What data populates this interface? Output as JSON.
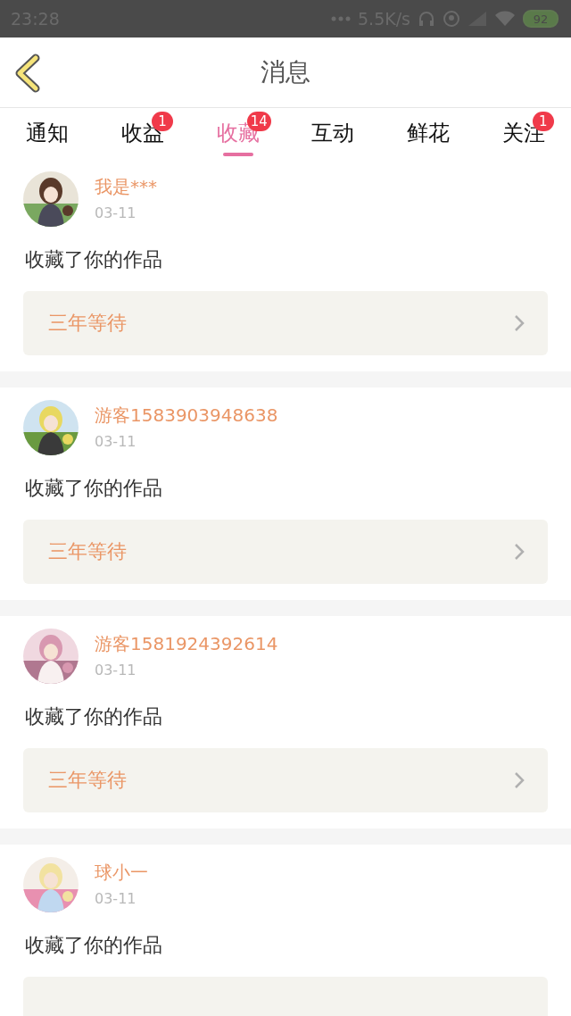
{
  "status_bar": {
    "time": "23:28",
    "speed": "5.5K/s",
    "battery": "92"
  },
  "header": {
    "title": "消息"
  },
  "tabs": [
    {
      "label": "通知",
      "selected": false
    },
    {
      "label": "收益",
      "selected": false,
      "badge": "1"
    },
    {
      "label": "收藏",
      "selected": true,
      "badge": "14"
    },
    {
      "label": "互动",
      "selected": false
    },
    {
      "label": "鲜花",
      "selected": false
    },
    {
      "label": "关注",
      "selected": false,
      "badge": "1"
    }
  ],
  "messages": [
    {
      "user": "我是***",
      "date": "03-11",
      "text": "收藏了你的作品",
      "work": "三年等待"
    },
    {
      "user": "游客1583903948638",
      "date": "03-11",
      "text": "收藏了你的作品",
      "work": "三年等待"
    },
    {
      "user": "游客1581924392614",
      "date": "03-11",
      "text": "收藏了你的作品",
      "work": "三年等待"
    },
    {
      "user": "球小一",
      "date": "03-11",
      "text": "收藏了你的作品"
    }
  ]
}
